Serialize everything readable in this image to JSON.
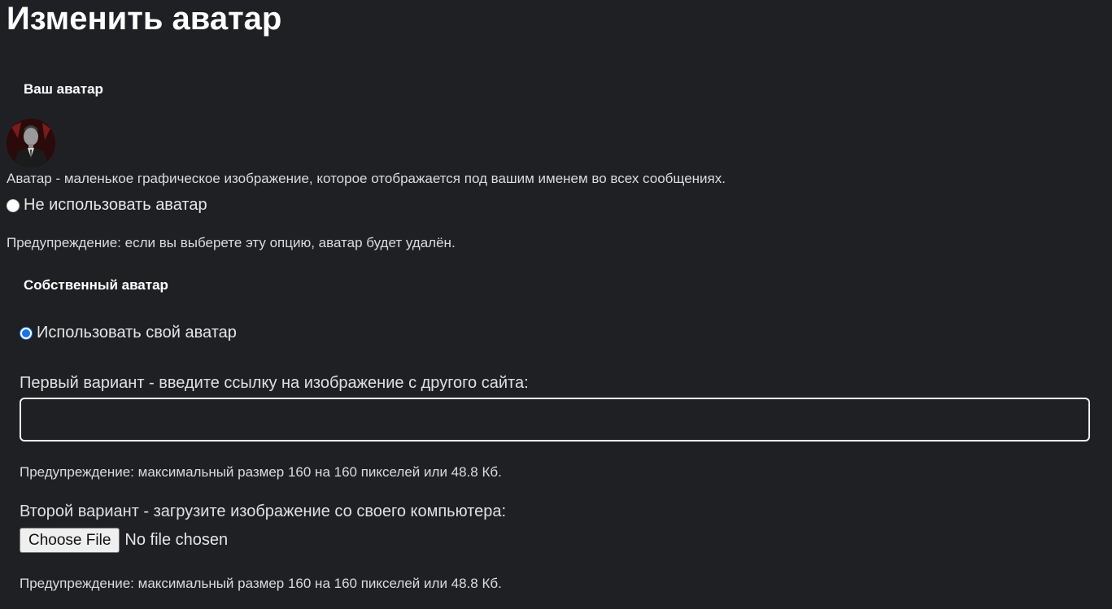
{
  "page": {
    "title": "Изменить аватар"
  },
  "your_avatar": {
    "heading": "Ваш аватар",
    "description": "Аватар - маленькое графическое изображение, которое отображается под вашим именем во всех сообщениях.",
    "no_avatar_label": "Не использовать аватар",
    "no_avatar_checked": false,
    "remove_warning": "Предупреждение: если вы выберете эту опцию, аватар будет удалён."
  },
  "custom_avatar": {
    "heading": "Собственный аватар",
    "use_own_label": "Использовать свой аватар",
    "use_own_checked": true,
    "url_label": "Первый вариант - введите ссылку на изображение с другого сайта:",
    "url_value": "",
    "url_placeholder": "",
    "size_warning_1": "Предупреждение: максимальный размер 160 на 160 пикселей или 48.8 Кб.",
    "upload_label": "Второй вариант - загрузите изображение со своего компьютера:",
    "choose_file_label": "Choose File",
    "no_file_text": "No file chosen",
    "size_warning_2": "Предупреждение: максимальный размер 160 на 160 пикселей или 48.8 Кб."
  },
  "colors": {
    "background": "#1f2024",
    "accent": "#1a73e8"
  }
}
